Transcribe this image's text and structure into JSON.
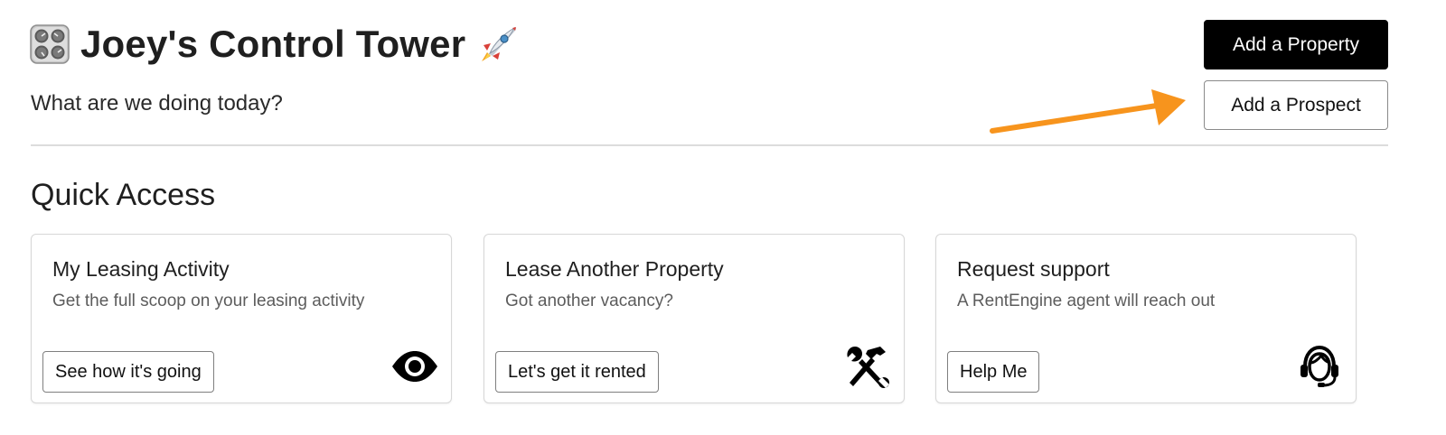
{
  "header": {
    "title": "Joey's Control Tower",
    "title_icon": "control-knobs-icon",
    "title_suffix_icon": "rocket-icon",
    "subtitle": "What are we doing today?",
    "add_property_label": "Add a Property",
    "add_prospect_label": "Add a Prospect",
    "annotation_arrow_color": "#F7941D"
  },
  "quick_access": {
    "title": "Quick Access",
    "cards": [
      {
        "title": "My Leasing Activity",
        "description": "Get the full scoop on your leasing activity",
        "button_label": "See how it's going",
        "icon": "eye-icon"
      },
      {
        "title": "Lease Another Property",
        "description": "Got another vacancy?",
        "button_label": "Let's get it rented",
        "icon": "tools-icon"
      },
      {
        "title": "Request support",
        "description": "A RentEngine agent will reach out",
        "button_label": "Help Me",
        "icon": "support-agent-icon"
      }
    ]
  }
}
